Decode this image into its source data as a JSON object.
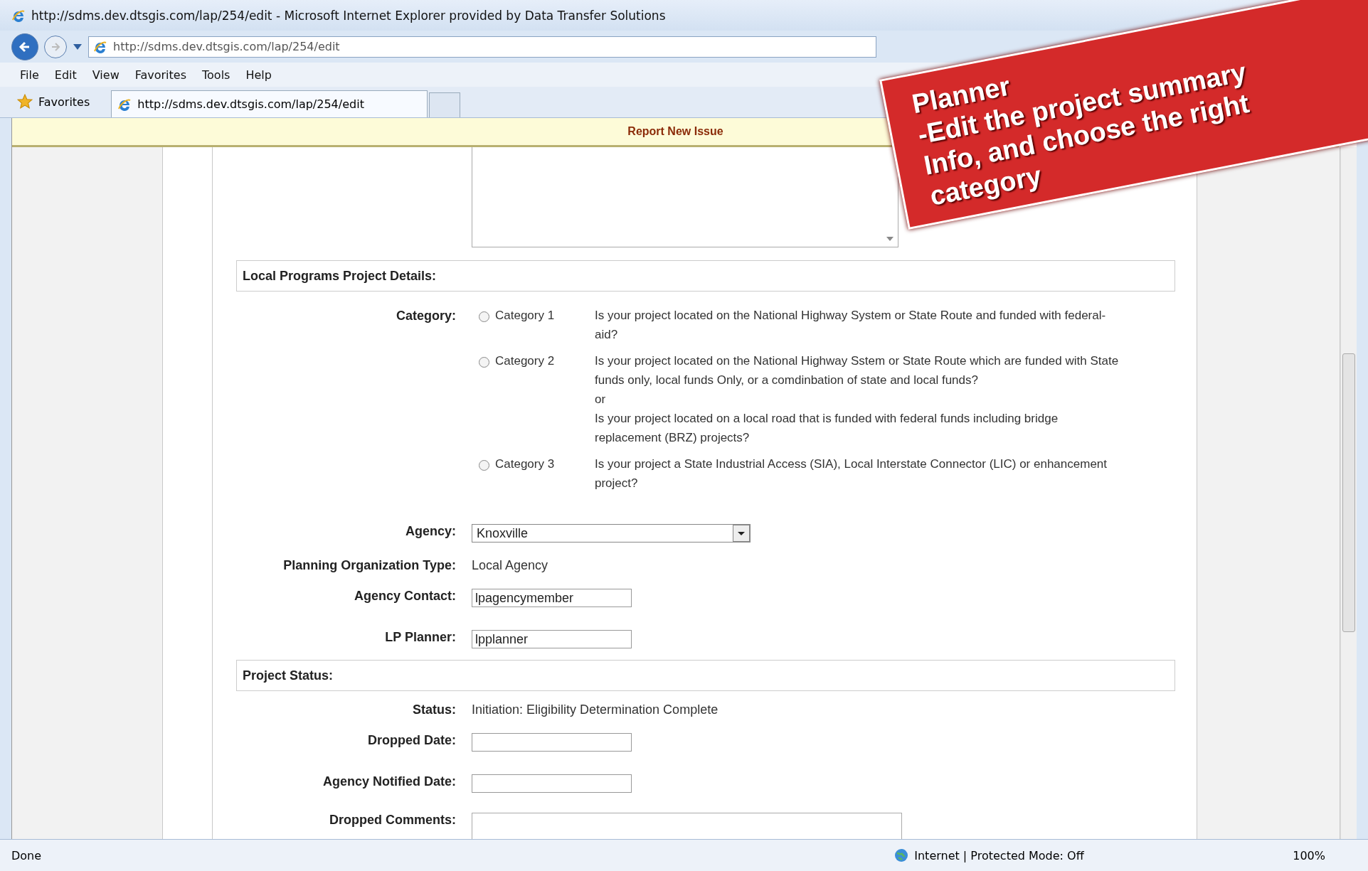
{
  "window": {
    "title": "http://sdms.dev.dtsgis.com/lap/254/edit - Microsoft Internet Explorer provided by Data Transfer Solutions"
  },
  "address_bar": {
    "url": "http://sdms.dev.dtsgis.com/lap/254/edit"
  },
  "menu": [
    "File",
    "Edit",
    "View",
    "Favorites",
    "Tools",
    "Help"
  ],
  "favorites_bar": {
    "label": "Favorites",
    "tabs": [
      {
        "label": "http://sdms.dev.dtsgis.com/lap/254/edit",
        "selected": true
      }
    ]
  },
  "header_bar": {
    "title": "Report New Issue"
  },
  "sections": [
    {
      "title": "Local Programs Project Details:",
      "rows": [
        {
          "kind": "radio",
          "label": "Category:",
          "options": [
            {
              "label": "Category 1",
              "selected": false,
              "lines": [
                "Is your project located on the National Highway System or State Route and funded with federal-aid?"
              ]
            },
            {
              "label": "Category 2",
              "selected": false,
              "lines": [
                "Is your project located on the National Highway Sstem or State Route which are funded with State funds only, local funds Only, or a comdinbation of state and local funds?",
                "or",
                "Is your project located on a local road that is funded with federal funds including bridge replacement (BRZ) projects?"
              ]
            },
            {
              "label": "Category 3",
              "selected": false,
              "lines": [
                "Is your project a State Industrial Access (SIA), Local Interstate Connector (LIC) or enhancement project?"
              ]
            }
          ]
        },
        {
          "kind": "select",
          "label": "Agency:",
          "value": "Knoxville"
        },
        {
          "kind": "text",
          "label": "Planning Organization Type:",
          "value": "Local Agency"
        },
        {
          "kind": "input",
          "label": "Agency Contact:",
          "value": "lpagencymember"
        },
        {
          "kind": "input",
          "label": "LP Planner:",
          "value": "lpplanner"
        }
      ]
    },
    {
      "title": "Project Status:",
      "rows": [
        {
          "kind": "text",
          "label": "Status:",
          "value": "Initiation: Eligibility Determination Complete"
        },
        {
          "kind": "input",
          "label": "Dropped Date:",
          "value": ""
        },
        {
          "kind": "input",
          "label": "Agency Notified Date:",
          "value": ""
        },
        {
          "kind": "textarea",
          "label": "Dropped Comments:"
        }
      ]
    }
  ],
  "status_bar": {
    "text": "Done",
    "zone": "Internet | Protected Mode: Off",
    "zoom": "100%"
  },
  "annotation": {
    "lines": [
      "Planner",
      "-Edit the project summary",
      "Info, and choose the right",
      "category"
    ]
  }
}
